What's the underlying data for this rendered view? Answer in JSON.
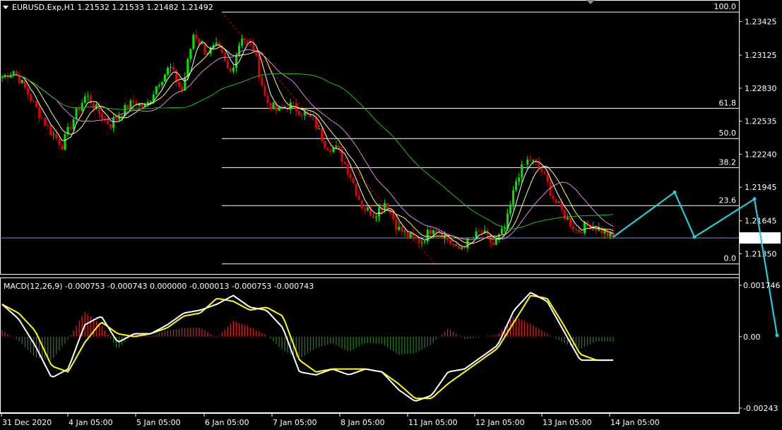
{
  "header": {
    "symbol_line": "EURUSD.Exp,H1  1.21532 1.21533 1.21482 1.21492",
    "menu_icon": "triangle-down-icon"
  },
  "indicator_header": "MACD(12,26,9) -0.000753 -0.000743 0.000000 -0.000013 -0.000753 -0.000743",
  "price_axis": [
    "1.23425",
    "1.23125",
    "1.22830",
    "1.22535",
    "1.22240",
    "1.21945",
    "1.21645",
    "1.21350"
  ],
  "current_price": "1.21492",
  "fib_levels": [
    {
      "label": "100.0",
      "price": 1.2351
    },
    {
      "label": "61.8",
      "price": 1.2265
    },
    {
      "label": "50.0",
      "price": 1.2238
    },
    {
      "label": "38.2",
      "price": 1.2212
    },
    {
      "label": "23.6",
      "price": 1.2178
    },
    {
      "label": "0.0",
      "price": 1.2126
    }
  ],
  "macd_axis": [
    "0.001746",
    "0.00",
    "-0.00243"
  ],
  "time_axis": [
    "31 Dec 2020",
    "4 Jan 05:00",
    "5 Jan 05:00",
    "6 Jan 05:00",
    "7 Jan 05:00",
    "8 Jan 05:00",
    "11 Jan 05:00",
    "12 Jan 05:00",
    "13 Jan 05:00",
    "14 Jan 05:00"
  ],
  "colors": {
    "background": "#000000",
    "grid": "#ffffff",
    "bull": "#00e400",
    "bear": "#e00000",
    "ma_fast": "#ffffff",
    "ma_yellow": "#ffff66",
    "ma_violet": "#dd88dd",
    "ma_green": "#22bb22",
    "projection": "#22ccdd",
    "macd_line": "#ffffff",
    "signal_line": "#ffff00"
  },
  "chart_data": {
    "type": "candlestick",
    "symbol": "EURUSD.Exp",
    "timeframe": "H1",
    "ohlc_last": {
      "open": 1.21532,
      "high": 1.21533,
      "low": 1.21482,
      "close": 1.21492
    },
    "price_range": [
      1.2117,
      1.2358
    ],
    "close_path": [
      1.2293,
      1.2299,
      1.2281,
      1.2262,
      1.2245,
      1.2232,
      1.2257,
      1.2277,
      1.2262,
      1.225,
      1.2262,
      1.2271,
      1.2266,
      1.2288,
      1.2302,
      1.228,
      1.2333,
      1.2315,
      1.232,
      1.2295,
      1.233,
      1.2318,
      1.2272,
      1.2262,
      1.2268,
      1.2262,
      1.2254,
      1.2232,
      1.2228,
      1.2207,
      1.2178,
      1.217,
      1.2182,
      1.2158,
      1.215,
      1.2146,
      1.216,
      1.215,
      1.2138,
      1.2147,
      1.2155,
      1.2143,
      1.2158,
      1.2205,
      1.222,
      1.221,
      1.2185,
      1.2168,
      1.2155,
      1.2162,
      1.2156,
      1.2149
    ],
    "fibonacci": [
      {
        "level": "100.0",
        "price": 1.2351
      },
      {
        "level": "61.8",
        "price": 1.2265
      },
      {
        "level": "50.0",
        "price": 1.2238
      },
      {
        "level": "38.2",
        "price": 1.2212
      },
      {
        "level": "23.6",
        "price": 1.2178
      },
      {
        "level": "0.0",
        "price": 1.2126
      }
    ],
    "projection": [
      1.215,
      1.219,
      1.215,
      1.2184,
      1.21
    ],
    "macd": {
      "params": "12,26,9",
      "range": [
        -0.00243,
        0.001746
      ],
      "main": [
        0.0011,
        0.0006,
        -0.0003,
        -0.0014,
        -0.0011,
        0.0004,
        0.0007,
        -0.0002,
        0.0001,
        0.0001,
        0.0004,
        0.0008,
        0.0009,
        0.0011,
        0.0014,
        0.001,
        0.0009,
        0.0003,
        -0.0012,
        -0.0013,
        -0.0011,
        -0.0013,
        -0.0011,
        -0.0012,
        -0.0018,
        -0.0022,
        -0.002,
        -0.0012,
        -0.0011,
        -0.0007,
        -0.0003,
        0.0009,
        0.0015,
        0.0012,
        0.0002,
        -0.0008,
        -0.0008,
        -0.0008
      ],
      "signal": [
        0.0011,
        0.0008,
        0.0002,
        -0.001,
        -0.0012,
        -0.0002,
        0.0005,
        0.0001,
        0.0,
        0.0001,
        0.0003,
        0.0007,
        0.0008,
        0.0013,
        0.0012,
        0.0009,
        0.001,
        0.0007,
        -0.0008,
        -0.0012,
        -0.0011,
        -0.0011,
        -0.0011,
        -0.0012,
        -0.0016,
        -0.0021,
        -0.0021,
        -0.0016,
        -0.0012,
        -0.0008,
        -0.0004,
        0.0005,
        0.0014,
        0.0013,
        0.0004,
        -0.0006,
        -0.0008,
        -0.0008
      ]
    }
  }
}
